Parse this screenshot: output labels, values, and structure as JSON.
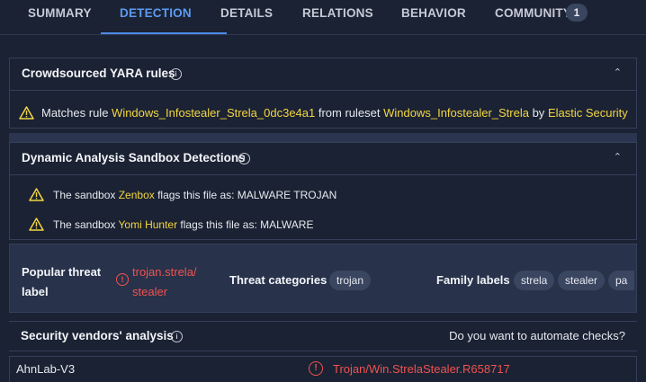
{
  "tabs": [
    {
      "label": "SUMMARY",
      "active": false
    },
    {
      "label": "DETECTION",
      "active": true
    },
    {
      "label": "DETAILS",
      "active": false
    },
    {
      "label": "RELATIONS",
      "active": false
    },
    {
      "label": "BEHAVIOR",
      "active": false
    },
    {
      "label": "COMMUNITY",
      "active": false,
      "badge": "1"
    }
  ],
  "yara": {
    "title": "Crowdsourced YARA rules",
    "match_prefix": "Matches rule ",
    "rule": "Windows_Infostealer_Strela_0dc3e4a1",
    "from_text": " from ruleset ",
    "ruleset": "Windows_Infostealer_Strela",
    "by_text": " by ",
    "author": "Elastic Security"
  },
  "sandbox": {
    "title": "Dynamic Analysis Sandbox Detections",
    "rows": [
      {
        "prefix": "The sandbox ",
        "name": "Zenbox",
        "suffix": " flags this file as: MALWARE TROJAN"
      },
      {
        "prefix": "The sandbox ",
        "name": "Yomi Hunter",
        "suffix": " flags this file as: MALWARE"
      }
    ]
  },
  "threat": {
    "popular_label_title_1": "Popular threat",
    "popular_label_title_2": "label",
    "popular_value_1": "trojan.strela/",
    "popular_value_2": "stealer",
    "categories_title": "Threat categories",
    "categories": [
      "trojan"
    ],
    "family_title": "Family labels",
    "families": [
      "strela",
      "stealer",
      "pa"
    ]
  },
  "vendors": {
    "title": "Security vendors' analysis",
    "automate_text": "Do you want to automate checks?",
    "rows": [
      {
        "vendor": "AhnLab-V3",
        "result": "Trojan/Win.StrelaStealer.R658717"
      }
    ]
  },
  "colors": {
    "accent": "#5b9bf0",
    "highlight": "#f2d642",
    "danger": "#ef5350",
    "background": "#1b2233"
  }
}
